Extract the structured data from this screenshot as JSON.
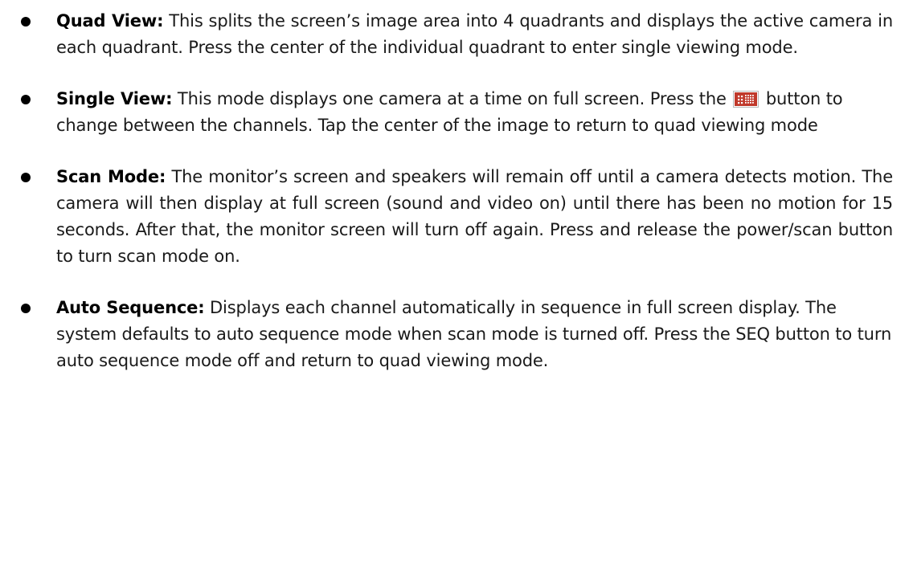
{
  "items": [
    {
      "term": "Quad View:",
      "text": " This splits the screen’s image area into 4 quadrants and displays the active camera in each quadrant. Press the center of the individual quadrant to enter single viewing mode."
    },
    {
      "term": "Single View:",
      "text_before": " This mode displays one camera at a time on full screen. Press the ",
      "icon": "channel-grid-icon",
      "text_after": " button to change between the channels. Tap the center of the image to return to quad viewing mode"
    },
    {
      "term": "Scan Mode:",
      "text": " The monitor’s screen and speakers will remain off until a camera detects motion. The camera will then display at full screen (sound and video on) until there has been no motion for 15 seconds. After that, the monitor screen will turn off again. Press and release the power/scan button to turn scan mode on."
    },
    {
      "term": "Auto Sequence:",
      "text": " Displays each channel automatically in sequence in full screen display. The system defaults to auto sequence mode when scan mode is turned off. Press the SEQ button to turn auto sequence mode off and return to quad viewing mode."
    }
  ],
  "colors": {
    "text": "#1a1a1a",
    "bullet": "#000000",
    "icon_background": "#c0392b",
    "icon_glyph": "#ffffff"
  }
}
